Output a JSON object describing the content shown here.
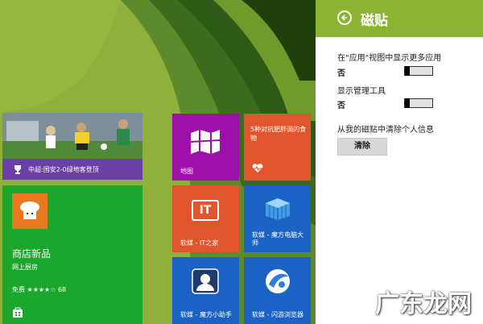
{
  "start_screen": {
    "tiles": {
      "sports": {
        "caption": "中超:国安2-0绿地客登顶",
        "icon": "trophy-icon",
        "color": "#6b3fa6"
      },
      "maps": {
        "label": "地图",
        "icon": "map-icon",
        "color": "#9c0fa8"
      },
      "health": {
        "headline": "5种对抗肥胖调的食物",
        "icon": "heart-pulse-icon",
        "color": "#e2542b"
      },
      "store": {
        "title": "商店新品",
        "subtitle": "网上厨房",
        "price_rating": "免费 ★★★★☆ 68",
        "icon": "store-bag-icon",
        "color": "#1aa72c"
      },
      "it_home": {
        "label": "软媒 - IT之家",
        "icon_text": "IT",
        "color": "#e2542b"
      },
      "cube_master": {
        "label": "软媒 - 魔方电脑大师",
        "icon": "cube-icon",
        "color": "#1a63c4"
      },
      "cube_assistant": {
        "label": "软媒 - 魔方小助手",
        "icon": "assistant-icon",
        "color": "#1a63c4"
      },
      "flash_browser": {
        "label": "软媒 - 闪游浏览器",
        "icon": "browser-icon",
        "color": "#1a63c4"
      }
    }
  },
  "panel": {
    "title": "磁贴",
    "back_icon": "back-arrow-icon",
    "settings": [
      {
        "label": "在\"应用\"视图中显示更多应用",
        "state": "否"
      },
      {
        "label": "显示管理工具",
        "state": "否"
      }
    ],
    "clear_label": "从我的磁贴中清除个人信息",
    "clear_button": "清除",
    "header_color": "#8db332"
  },
  "watermark": "广东龙网"
}
